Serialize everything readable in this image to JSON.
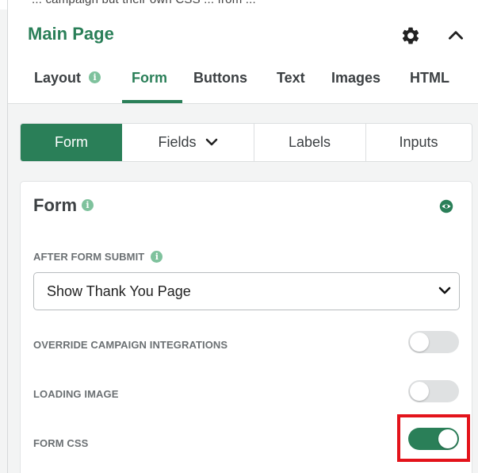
{
  "top_strip_text": "... campaign but their own CSS ... from ... ",
  "header": {
    "title": "Main Page",
    "tabs": [
      {
        "label": "Layout"
      },
      {
        "label": "Form"
      },
      {
        "label": "Buttons"
      },
      {
        "label": "Text"
      },
      {
        "label": "Images"
      },
      {
        "label": "HTML"
      }
    ],
    "active_tab": "Form",
    "info_glyph": "i"
  },
  "subtabs": [
    {
      "label": "Form"
    },
    {
      "label": "Fields"
    },
    {
      "label": "Labels"
    },
    {
      "label": "Inputs"
    }
  ],
  "active_subtab": "Form",
  "card": {
    "title": "Form",
    "after_submit_label": "AFTER FORM SUBMIT",
    "after_submit_value": "Show Thank You Page",
    "settings": [
      {
        "label": "OVERRIDE CAMPAIGN INTEGRATIONS",
        "enabled": false
      },
      {
        "label": "LOADING IMAGE",
        "enabled": false
      },
      {
        "label": "FORM CSS",
        "enabled": true
      }
    ]
  },
  "colors": {
    "accent": "#2a7f58",
    "info_badge": "#7fc29d",
    "highlight": "#e3131b",
    "toggle_off": "#dfe1e2"
  },
  "icons": [
    "gear-icon",
    "chevron-up-icon",
    "info-icon",
    "chevron-down-icon",
    "eye-icon"
  ]
}
